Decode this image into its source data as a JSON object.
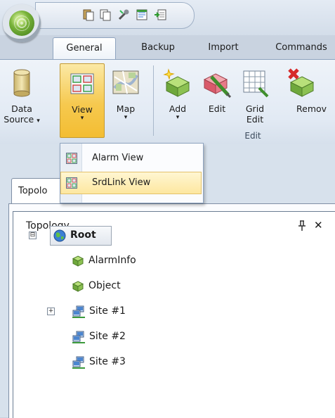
{
  "ribbon_tabs": [
    {
      "label": "General",
      "active": true
    },
    {
      "label": "Backup",
      "active": false
    },
    {
      "label": "Import",
      "active": false
    },
    {
      "label": "Commands",
      "active": false
    }
  ],
  "ribbon_buttons": {
    "data_source": {
      "line1": "Data",
      "line2": "Source",
      "caret": "▾",
      "icon": "database-icon"
    },
    "view": {
      "label": "View",
      "caret": "▾",
      "icon": "view-grid-icon",
      "pressed": true
    },
    "map": {
      "label": "Map",
      "caret": "▾",
      "icon": "map-icon"
    },
    "add": {
      "label": "Add",
      "caret": "▾",
      "icon": "add-cube-icon"
    },
    "edit": {
      "label": "Edit",
      "icon": "edit-pencil-icon"
    },
    "grid_edit": {
      "line1": "Grid",
      "line2": "Edit",
      "icon": "grid-icon"
    },
    "remove": {
      "label": "Remov",
      "icon": "remove-icon"
    }
  },
  "ribbon_groups": {
    "edit_label": "Edit"
  },
  "view_dropdown": {
    "items": [
      {
        "label": "Alarm View",
        "icon": "view-grid-icon",
        "highlighted": false
      },
      {
        "label": "SrdLink View",
        "icon": "view-grid-icon",
        "highlighted": true
      }
    ]
  },
  "document_tab": {
    "label": "Topolo"
  },
  "topology_panel": {
    "title": "Topology",
    "pin_glyph": "ᵽ",
    "close_glyph": "✕",
    "tree": [
      {
        "label": "Root",
        "icon": "globe-icon",
        "expander": "⊟",
        "bold": true
      },
      {
        "label": "AlarmInfo",
        "icon": "cube-icon"
      },
      {
        "label": "Object",
        "icon": "cube-icon"
      },
      {
        "label": "Site #1",
        "icon": "network-icon",
        "expander": "+"
      },
      {
        "label": "Site #2",
        "icon": "network-icon"
      },
      {
        "label": "Site #3",
        "icon": "network-icon"
      }
    ]
  },
  "colors": {
    "accent": "#f6c94f",
    "ribbon_border": "#8fa4bf",
    "highlight": "#fde7a0"
  }
}
